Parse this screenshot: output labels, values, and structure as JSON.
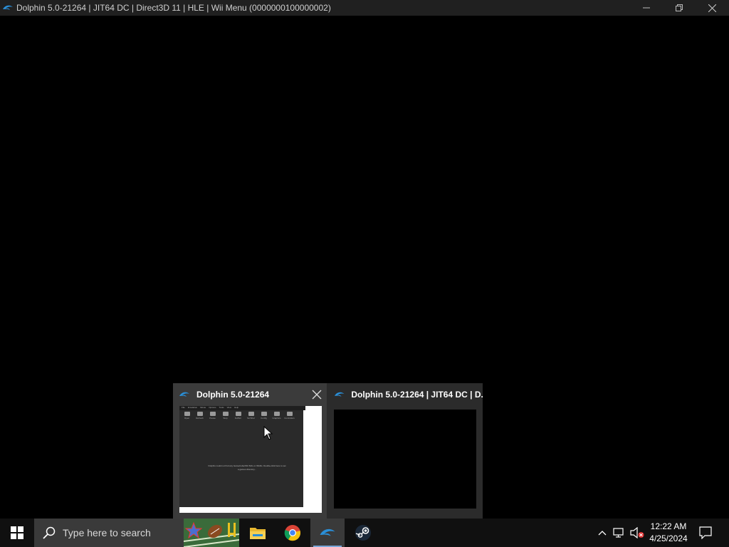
{
  "window": {
    "title": "Dolphin 5.0-21264 | JIT64 DC | Direct3D 11 | HLE | Wii Menu (0000000100000002)",
    "controls": [
      "minimize",
      "restore",
      "close"
    ]
  },
  "thumbnails": [
    {
      "label": "Dolphin 5.0-21264",
      "mini_menu": [
        "File",
        "Emulation",
        "Movie",
        "Options",
        "Tools",
        "View",
        "Help"
      ],
      "mini_toolbar": [
        "Open",
        "Refresh",
        "Pause",
        "Stop",
        "FullScr",
        "ScrShot",
        "Config",
        "Graphics",
        "Controllers"
      ],
      "mini_message": "Dolphin could not find any GameCube/Wii ISOs or WADs. Double-click here to set a games directory..."
    },
    {
      "label": "Dolphin 5.0-21264 | JIT64 DC | D..."
    }
  ],
  "taskbar": {
    "search_placeholder": "Type here to search",
    "apps": [
      "file-explorer",
      "google-chrome",
      "dolphin",
      "steam"
    ],
    "active_app": "dolphin",
    "clock_time": "12:22 AM",
    "clock_date": "4/25/2024"
  },
  "colors": {
    "dolphin_blue": "#2a8fd8",
    "titlebar": "#202020",
    "taskbar": "#101010"
  }
}
